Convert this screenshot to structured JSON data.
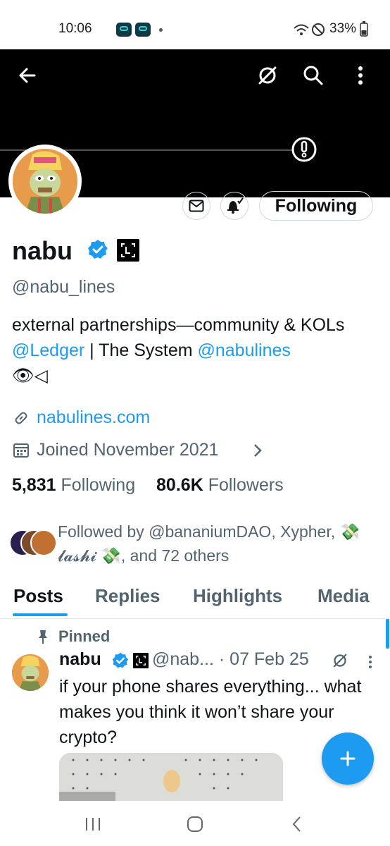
{
  "status_bar": {
    "time": "10:06",
    "battery": "33%"
  },
  "profile": {
    "name": "nabu",
    "handle": "@nabu_lines",
    "bio": {
      "part1": "external partnerships—community & KOLs ",
      "link1": "@Ledger",
      "part2": " | The System ",
      "link2": "@nabulines",
      "emoji": "👁◁"
    },
    "website": "nabulines.com",
    "joined": "Joined November 2021",
    "following_count": "5,831",
    "following_label": "Following",
    "followers_count": "80.6K",
    "followers_label": "Followers",
    "followed_by": "Followed by @bananiumDAO, Xypher, 💸 𝓵𝓪𝓼𝓱𝓲 💸, and 72 others",
    "follow_button": "Following"
  },
  "tabs": [
    "Posts",
    "Replies",
    "Highlights",
    "Media"
  ],
  "post": {
    "pinned_label": "Pinned",
    "author": "nabu",
    "handle": "@nab...",
    "date": "· 07 Feb 25",
    "text": "if your phone shares everything... what makes you think it won’t share your crypto?"
  },
  "colors": {
    "accent": "#1d9bf0",
    "banner": "#000000"
  }
}
